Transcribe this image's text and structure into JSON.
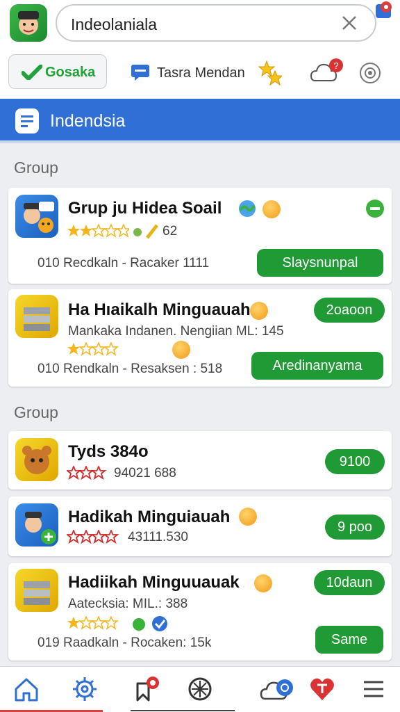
{
  "search": {
    "value": "Indeolaniala"
  },
  "header": {
    "chip_label": "Gosaka",
    "tab_label": "Tasra Mendan",
    "notification_count": "?"
  },
  "bluebar": {
    "title": "Indendsia"
  },
  "sections": [
    {
      "label": "Group"
    },
    {
      "label": "Group"
    }
  ],
  "cards": [
    {
      "title": "Grup ju Hidea Soail",
      "rating_text": "62",
      "meta": "010  Recdkaln - Racaker 1111",
      "button": "Slaysnunpal"
    },
    {
      "title": "Ha Hıaikalh Minguauah",
      "subtitle": "Mankaka Indanen. Nengiian ML: 145",
      "meta": "010  Rendkaln - Resaksen : 518",
      "badge": "2oaoon",
      "button": "Aredinanyama"
    },
    {
      "title": "Tyds 384o",
      "rating_text": "94021 688",
      "badge": "9100"
    },
    {
      "title": "Hadikah Minguiauah",
      "rating_text": "43111.530",
      "badge": "9 poo"
    },
    {
      "title": "Hadiikah Minguuauak",
      "subtitle": "Aatecksia: MIL.: 388",
      "meta": "019  Raadkaln - Rocaken: 15k",
      "badge": "10daun",
      "button": "Same"
    }
  ],
  "colors": {
    "accent_green": "#1f9a35",
    "brand_blue": "#2f6fd6",
    "alert_red": "#d94040"
  },
  "icons": [
    "home-icon",
    "gear-icon",
    "bookmark-icon",
    "compass-icon",
    "cloud-icon",
    "heart-icon",
    "menu-icon"
  ]
}
